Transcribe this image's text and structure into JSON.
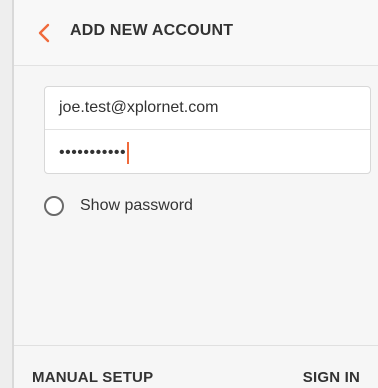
{
  "header": {
    "title": "ADD NEW ACCOUNT",
    "back_icon": "chevron-left-icon"
  },
  "form": {
    "email_value": "joe.test@xplornet.com",
    "password_value": "•••••••••••"
  },
  "options": {
    "show_password_label": "Show password",
    "show_password_checked": false
  },
  "footer": {
    "manual_setup_label": "MANUAL SETUP",
    "sign_in_label": "SIGN IN"
  },
  "colors": {
    "accent": "#f06a3b",
    "text": "#333333",
    "background": "#f6f6f6"
  }
}
